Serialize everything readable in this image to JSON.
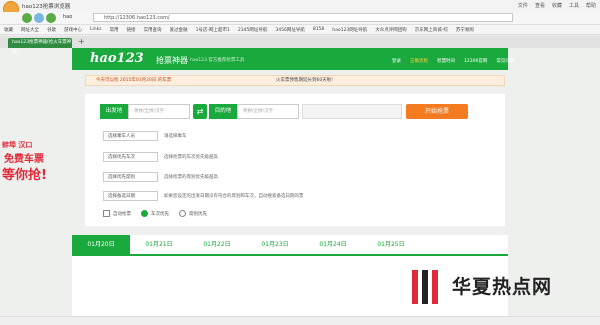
{
  "browser": {
    "title": "hao123抢票浏览器",
    "menu": [
      "文件",
      "查看",
      "收藏",
      "工具",
      "帮助"
    ],
    "address": "http://12306.hao123.com/",
    "bookmarks": [
      "收藏",
      "网址大全",
      "谷歌",
      "游戏中心",
      "Links",
      "常用",
      "链接",
      "实用查询",
      "爱过金融",
      "1号店-网上超市1",
      "2345网址导航",
      "3456网址导航",
      "8158",
      "hao123网址导航",
      "大众点评网团购",
      "京东网上商城-综",
      "苏宁易购"
    ],
    "tab_label": "hao123抢票神器(抢火车票神器)"
  },
  "site": {
    "logo": "hao123",
    "subtitle": "抢票神器",
    "slogan": "hao123 官方推荐抢票工具",
    "nav": [
      "登录",
      "正确流程",
      "智慧时间",
      "12306官网",
      "常见问题"
    ]
  },
  "notice": {
    "text": "今天可以抢 2015年03月20日 的车票",
    "text2": "火车票预售期延长到60天啦!"
  },
  "form": {
    "from_label": "出发地",
    "from_placeholder": "简拼/全拼/汉字",
    "to_label": "目的地",
    "to_placeholder": "简拼/全拼/汉字",
    "grab_button": "开始抢票",
    "rows": [
      {
        "select": "选择乘车人员",
        "hint": "请选择乘车"
      },
      {
        "select": "选择优先车次",
        "hint": "选择抢票的车次优先级越高"
      },
      {
        "select": "选择优先席别",
        "hint": "选择抢票的席别优先级越高"
      },
      {
        "select": "选择备选日期",
        "hint": "如果您设定的出发日期没有符合的席别和车次，自动搜索备选日期的票"
      }
    ],
    "options": [
      "自动抢票",
      "车次优先",
      "席别优先"
    ]
  },
  "dates": [
    "01月20日",
    "01月21日",
    "01月22日",
    "01月23日",
    "01月24日",
    "01月25日"
  ],
  "ad": {
    "line1": "蚌埠 汉口",
    "line2": "免费车票",
    "line3": "等你抢!"
  },
  "watermark": "华夏热点网",
  "colors": {
    "brand": "#1aa93c",
    "accent": "#f47b20"
  }
}
